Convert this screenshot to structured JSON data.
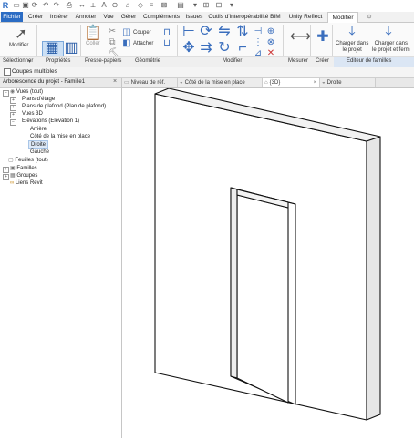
{
  "app": {
    "file_tab": "Fichier",
    "tabs": [
      "Créer",
      "Insérer",
      "Annoter",
      "Vue",
      "Gérer",
      "Compléments",
      "Issues",
      "Outils d'interopérabilité BIM",
      "Unity Reflect",
      "Modifier"
    ]
  },
  "ribbon": {
    "modifier_label": "Modifier",
    "coller_label": "Coller",
    "couper_label": "Couper",
    "attacher_label": "Attacher",
    "charger_projet_label": "Charger dans\nle projet",
    "charger_fermer_label": "Charger dans\nle projet et ferm",
    "panels": [
      "Sélectionner",
      "Propriétés",
      "Presse-papiers",
      "Géométrie",
      "Modifier",
      "Mesurer",
      "Créer",
      "Editeur de familles"
    ]
  },
  "options_bar": {
    "coupes_multiples": "Coupes multiples"
  },
  "browser": {
    "title": "Arborescence du projet - Famille1",
    "items": [
      "Vues (tout)",
      "Plans d'étage",
      "Plans de plafond (Plan de plafond)",
      "Vues 3D",
      "Elévations (Elévation 1)",
      "Arrière",
      "Côté de la mise en place",
      "Droite",
      "Gauche",
      "Feuilles (tout)",
      "Familles",
      "Groupes",
      "Liens Revit"
    ]
  },
  "view_tabs": [
    "Niveau de réf.",
    "Côté de la mise en place",
    "{3D}",
    "Droite"
  ],
  "colors": {
    "accent": "#2b6cc4",
    "ribbon_bg": "#fafafa",
    "highlight": "#cce0f5"
  }
}
